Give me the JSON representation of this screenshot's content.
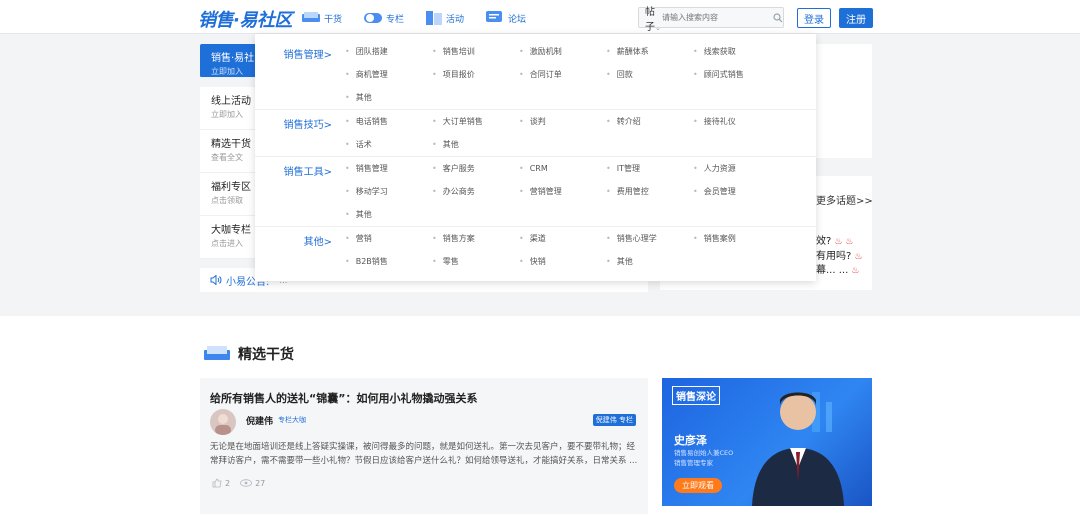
{
  "header": {
    "logo": "销售·易社区",
    "nav": [
      {
        "label": "干货"
      },
      {
        "label": "专栏"
      },
      {
        "label": "活动"
      },
      {
        "label": "论坛"
      }
    ],
    "search_type": "帖子",
    "search_placeholder": "请输入搜索内容",
    "login": "登录",
    "register": "注册"
  },
  "sidebar": {
    "items": [
      {
        "title": "销售·易社区",
        "sub": "立即加入"
      },
      {
        "title": "线上活动",
        "sub": "立即加入"
      },
      {
        "title": "精选干货",
        "sub": "查看全文"
      },
      {
        "title": "福利专区",
        "sub": "点击领取"
      },
      {
        "title": "大咖专栏",
        "sub": "点击进入"
      }
    ]
  },
  "announcement": {
    "label": "小易公告:",
    "text": "…"
  },
  "right_panel": {
    "more": "更多话题>>",
    "lines": [
      "效?",
      "有用吗?",
      "幕... ..."
    ]
  },
  "mega_menu": [
    {
      "title": "销售管理>",
      "items": [
        "团队搭建",
        "销售培训",
        "激励机制",
        "薪酬体系",
        "线索获取",
        "商机管理",
        "项目报价",
        "合同订单",
        "回款",
        "顾问式销售",
        "其他"
      ]
    },
    {
      "title": "销售技巧>",
      "items": [
        "电话销售",
        "大订单销售",
        "谈判",
        "转介绍",
        "接待礼仪",
        "话术",
        "其他"
      ]
    },
    {
      "title": "销售工具>",
      "items": [
        "销售管理",
        "客户服务",
        "CRM",
        "IT管理",
        "人力资源",
        "移动学习",
        "办公商务",
        "营销管理",
        "费用管控",
        "会员管理",
        "其他"
      ]
    },
    {
      "title": "其他>",
      "items": [
        "营销",
        "销售方案",
        "渠道",
        "销售心理学",
        "销售案例",
        "B2B销售",
        "零售",
        "快销",
        "其他"
      ]
    }
  ],
  "section": {
    "title": "精选干货"
  },
  "article": {
    "title": "给所有销售人的送礼“锦囊”：如何用小礼物撬动强关系",
    "author": "倪建伟",
    "author_tag": "专栏大咖",
    "badge": "倪建伟 专栏",
    "body": "无论是在地面培训还是线上答疑实操课，被问得最多的问题，就是如何送礼。第一次去见客户，要不要带礼物；经常拜访客户，需不需要带一些小礼物？节假日应该给客户送什么礼？如何给领导送礼，才能搞好关系，日常关系 ...",
    "likes": "2",
    "views": "27"
  },
  "promo": {
    "logo": "销售深论",
    "name": "史彦泽",
    "sub1": "销售易创始人兼CEO",
    "sub2": "销售管理专家",
    "button": "立即观看"
  },
  "colors": {
    "brand": "#1f6fd8",
    "orange": "#ff7a1a"
  }
}
